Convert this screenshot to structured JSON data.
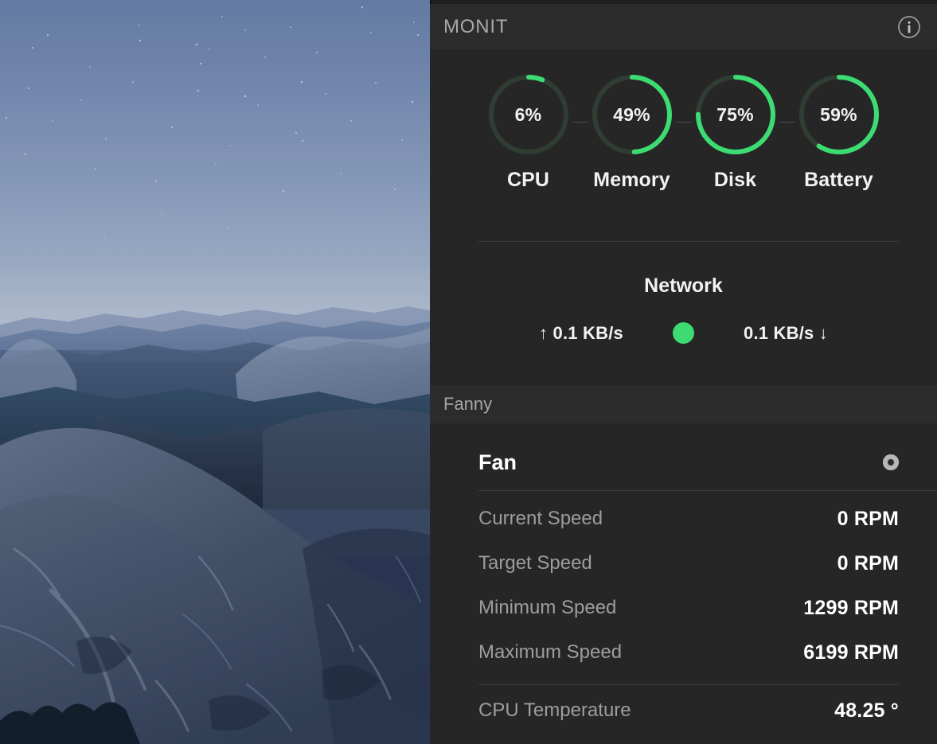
{
  "panel": {
    "monit": {
      "title": "MONIT",
      "info_icon": "info-icon",
      "gauges": [
        {
          "label": "CPU",
          "value_text": "6%",
          "percent": 6
        },
        {
          "label": "Memory",
          "value_text": "49%",
          "percent": 49
        },
        {
          "label": "Disk",
          "value_text": "75%",
          "percent": 75
        },
        {
          "label": "Battery",
          "value_text": "59%",
          "percent": 59
        }
      ],
      "network": {
        "title": "Network",
        "upload": "↑ 0.1 KB/s",
        "download": "0.1 KB/s ↓",
        "status_dot": "network-status-dot"
      }
    },
    "fanny": {
      "title": "Fanny",
      "fan_name": "Fan",
      "fan_indicator": "fan-status-indicator",
      "stats": [
        {
          "label": "Current Speed",
          "value": "0 RPM"
        },
        {
          "label": "Target Speed",
          "value": "0 RPM"
        },
        {
          "label": "Minimum Speed",
          "value": "1299 RPM"
        },
        {
          "label": "Maximum Speed",
          "value": "6199 RPM"
        }
      ],
      "temperature": {
        "label": "CPU Temperature",
        "value": "48.25 °"
      }
    }
  },
  "colors": {
    "accent_green": "#3ddc72",
    "gauge_track": "#2f3d33",
    "panel_bg": "#262626",
    "header_bg": "#2c2c2c",
    "text_primary": "#ffffff",
    "text_muted": "#9d9d9d"
  },
  "desktop": {
    "wallpaper_name": "yosemite-twilight-valley"
  }
}
